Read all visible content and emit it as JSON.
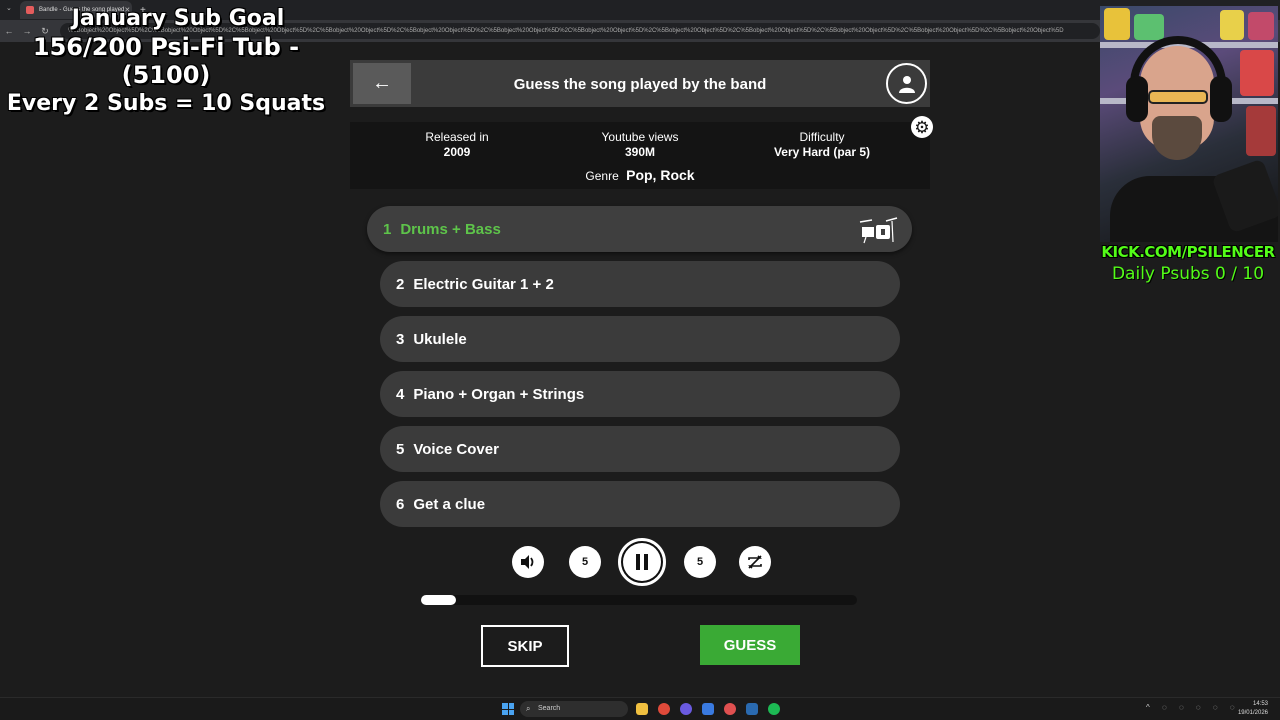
{
  "browser": {
    "tab_title": "Bandle - Guess the song played",
    "url": "%5Bobject%20Object%5D%2C%5Bobject%20Object%5D%2C%5Bobject%20Object%5D%2C%5Bobject%20Object%5D%2C%5Bobject%20Object%5D%2C%5Bobject%20Object%5D%2C%5Bobject%20Object%5D%2C%5Bobject%20Object%5D%2C%5Bobject%20Object%5D%2C%5Bobject%20Object%5D%2C%5Bobject%20Object%5D%2C%5Bobject%20Object%5D"
  },
  "overlay": {
    "goal_line1": "January Sub Goal",
    "goal_line2": "156/200 Psi-Fi Tub - (5100)",
    "goal_line3": "Every 2 Subs = 10 Squats",
    "kick_url": "KICK.COM/PSILENCER",
    "daily_subs": "Daily Psubs 0 / 10",
    "accent_color": "#53fc18"
  },
  "app": {
    "title": "Guess the song played by the band",
    "info": {
      "released_label": "Released in",
      "released_value": "2009",
      "views_label": "Youtube views",
      "views_value": "390M",
      "difficulty_label": "Difficulty",
      "difficulty_value": "Very Hard (par 5)",
      "genre_label": "Genre",
      "genre_value": "Pop, Rock"
    },
    "stems": [
      {
        "num": "1",
        "label": "Drums + Bass",
        "active": true
      },
      {
        "num": "2",
        "label": "Electric Guitar 1 + 2",
        "active": false
      },
      {
        "num": "3",
        "label": "Ukulele",
        "active": false
      },
      {
        "num": "4",
        "label": "Piano + Organ + Strings",
        "active": false
      },
      {
        "num": "5",
        "label": "Voice Cover",
        "active": false
      },
      {
        "num": "6",
        "label": "Get a clue",
        "active": false
      }
    ],
    "controls": {
      "rewind_label": "5",
      "forward_label": "5"
    },
    "progress": 0.08,
    "skip_label": "SKIP",
    "guess_label": "GUESS",
    "active_color": "#5ec44a",
    "guess_color": "#3aaa35"
  },
  "taskbar": {
    "search_placeholder": "Search",
    "clock_time": "14:53",
    "clock_date": "19/01/2026"
  }
}
